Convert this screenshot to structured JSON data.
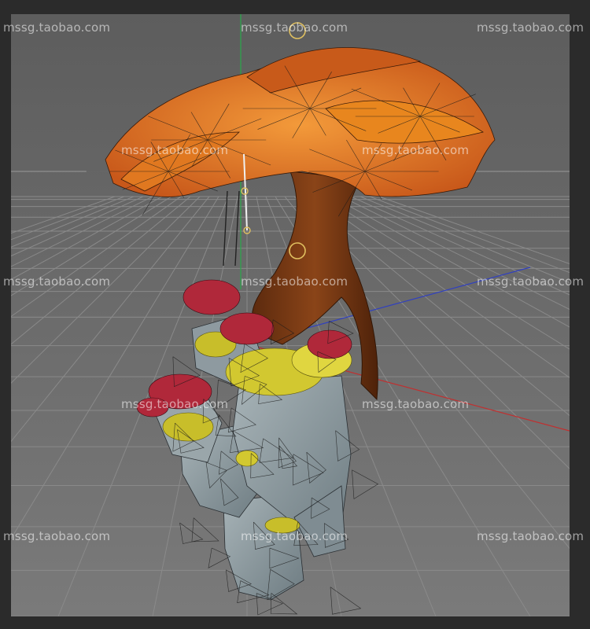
{
  "watermark": {
    "text": "mssg.taobao.com"
  },
  "colors": {
    "frame": "#2b2b2b",
    "viewport_bg": "#6e6e6e",
    "grid_line": "#8a8a8a",
    "x_axis": "#c03030",
    "y_axis": "#2aa84a",
    "z_axis": "#3040c0",
    "foliage": "#e07820",
    "trunk": "#7a3a14",
    "rock": "#8c9aa0",
    "moss": "#d2c830",
    "shrub": "#b0283a",
    "gizmo": "#e0c060"
  },
  "icons": [
    "move-gizmo-icon",
    "pivot-gizmo-icon",
    "ik-handle-icon"
  ]
}
